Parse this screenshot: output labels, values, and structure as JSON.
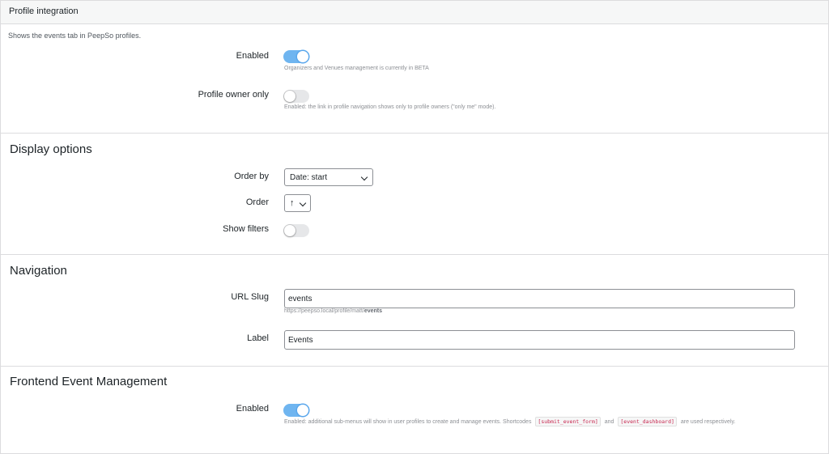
{
  "profile_integration": {
    "title": "Profile integration",
    "description": "Shows the events tab in PeepSo profiles.",
    "enabled_label": "Enabled",
    "enabled_on": true,
    "enabled_help": "Organizers and Venues management is currently in BETA",
    "owner_only_label": "Profile owner only",
    "owner_only_on": false,
    "owner_only_help": "Enabled: the link in profile navigation shows only to profile owners (\"only me\" mode)."
  },
  "display_options": {
    "title": "Display options",
    "order_by_label": "Order by",
    "order_by_value": "Date: start",
    "order_label": "Order",
    "order_value": "↑",
    "show_filters_label": "Show filters",
    "show_filters_on": false
  },
  "navigation": {
    "title": "Navigation",
    "url_slug_label": "URL Slug",
    "url_slug_value": "events",
    "url_help_prefix": "https://peepso.local/profile/matt/",
    "url_help_slug": "events",
    "label_label": "Label",
    "label_value": "Events"
  },
  "frontend": {
    "title": "Frontend Event Management",
    "enabled_label": "Enabled",
    "enabled_on": true,
    "help_prefix": "Enabled: additional sub-menus will show in user profiles to create and manage events. Shortcodes",
    "shortcode_1": "[submit_event_form]",
    "help_and": "and",
    "shortcode_2": "[event_dashboard]",
    "help_suffix": "are used respectively."
  },
  "colors": {
    "toggle_on": "#6fb5f0",
    "toggle_off": "#e6e7e9",
    "shortcode_text": "#c7254e"
  }
}
